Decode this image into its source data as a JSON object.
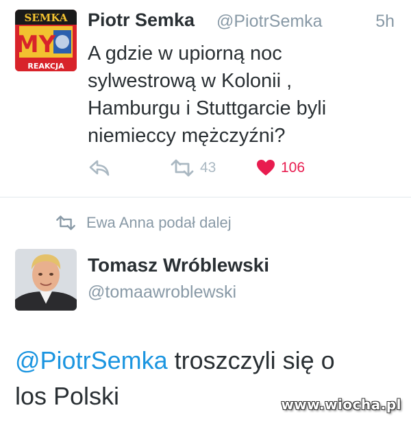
{
  "tweet": {
    "avatar_text_top": "SEMKA",
    "avatar_text_mid": "MY",
    "avatar_text_bottom": "REAKCJA",
    "author_name": "Piotr Semka",
    "author_handle": "@PiotrSemka",
    "time": "5h",
    "lines": [
      "A gdzie w upiorną noc",
      "sylwestrową w Kolonii ,",
      "Hamburgu i Stuttgarcie byli",
      "niemieccy mężczyźni?"
    ],
    "retweet_count": "43",
    "like_count": "106",
    "icons": {
      "reply": "reply-icon",
      "retweet": "retweet-icon",
      "like": "heart-icon"
    }
  },
  "retweet_context": {
    "icon": "retweet-icon",
    "text": "Ewa Anna podał dalej"
  },
  "reply": {
    "author_name": "Tomasz Wróblewski",
    "author_handle": "@tomaawroblewski",
    "mention": "@PiotrSemka",
    "text_after_mention": " troszczyli się o",
    "text_line2": "los Polski"
  },
  "watermark": "www.wiocha.pl",
  "colors": {
    "text": "#292f33",
    "secondary": "#8899a6",
    "mention": "#1b95e0",
    "like": "#e81c4f",
    "icon_gray": "#aab8c2",
    "divider": "#e1e8ed"
  }
}
